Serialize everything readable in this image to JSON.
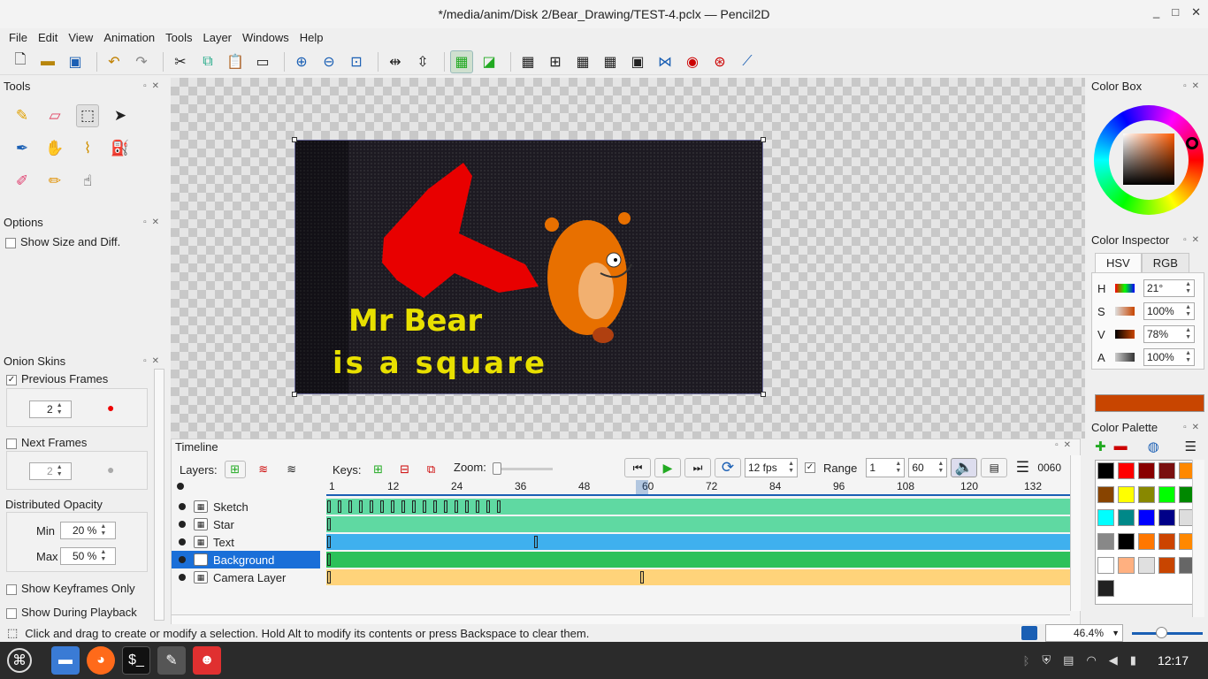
{
  "window": {
    "title": "*/media/anim/Disk 2/Bear_Drawing/TEST-4.pclx — Pencil2D",
    "minimize": "_",
    "maximize": "□",
    "close": "✕"
  },
  "menu": [
    "File",
    "Edit",
    "View",
    "Animation",
    "Tools",
    "Layer",
    "Windows",
    "Help"
  ],
  "toolbar": {
    "icons": [
      "new-file",
      "open",
      "save",
      "undo",
      "redo",
      "cut",
      "copy",
      "paste",
      "clear-frame",
      "zoom-in",
      "zoom-out",
      "zoom-fit",
      "flip-horizontal",
      "flip-vertical",
      "overlay-a",
      "overlay-b",
      "grid",
      "center",
      "thirds",
      "golden-ratio",
      "safe-area",
      "camera-path",
      "onion-front",
      "onion-back",
      "perspective"
    ]
  },
  "tools": {
    "title": "Tools",
    "items": [
      "pencil",
      "eraser",
      "select",
      "pointer",
      "pen",
      "hand",
      "polyline",
      "bucket",
      "eyedropper",
      "brush",
      "smudge"
    ]
  },
  "options": {
    "title": "Options",
    "show_size": "Show Size and Diff."
  },
  "onion": {
    "title": "Onion Skins",
    "previous": "Previous Frames",
    "prev_value": "2",
    "next": "Next Frames",
    "next_value": "2",
    "distributed": "Distributed Opacity",
    "min_label": "Min",
    "min_value": "20 %",
    "max_label": "Max",
    "max_value": "50 %",
    "show_keyframes_only": "Show Keyframes Only",
    "show_during_playback": "Show During Playback"
  },
  "canvas": {
    "text_line1": "Mr Bear",
    "text_line2": "is a square",
    "text_color": "#e8e000",
    "shape_color": "#e80000",
    "bear_color": "#e87000"
  },
  "timeline": {
    "title": "Timeline",
    "layers_label": "Layers:",
    "keys_label": "Keys:",
    "zoom_label": "Zoom:",
    "fps": "12 fps",
    "range_label": "Range",
    "range_start": "1",
    "range_end": "60",
    "frame_counter": "0060",
    "ruler": [
      "1",
      "12",
      "24",
      "36",
      "48",
      "60",
      "72",
      "84",
      "96",
      "108",
      "120",
      "132"
    ],
    "layers": [
      {
        "name": "Sketch",
        "color": "#5fd9a2",
        "selected": false
      },
      {
        "name": "Star",
        "color": "#5fd9a2",
        "selected": false
      },
      {
        "name": "Text",
        "color": "#3fb0ee",
        "selected": false
      },
      {
        "name": "Background",
        "color": "#2cc15a",
        "selected": true
      },
      {
        "name": "Camera Layer",
        "color": "#ffd37a",
        "selected": false
      }
    ]
  },
  "colorbox": {
    "title": "Color Box"
  },
  "inspector": {
    "title": "Color Inspector",
    "tab_hsv": "HSV",
    "tab_rgb": "RGB",
    "h_label": "H",
    "h_value": "21°",
    "s_label": "S",
    "s_value": "100%",
    "v_label": "V",
    "v_value": "78%",
    "a_label": "A",
    "a_value": "100%",
    "current_color": "#c84500"
  },
  "palette": {
    "title": "Color Palette",
    "colors": [
      "#000000",
      "#ff0000",
      "#880000",
      "#7a1010",
      "#ff8800",
      "#884400",
      "#ffff00",
      "#888800",
      "#00ff00",
      "#008800",
      "#00ffff",
      "#008888",
      "#0000ff",
      "#000088",
      "#dddddd",
      "#888888",
      "#000000",
      "#ff7700",
      "#cc4400",
      "#ff8800",
      "#ffffff",
      "#ffb080",
      "#e0e0e0",
      "#c84500",
      "#666666",
      "#222222"
    ]
  },
  "status": {
    "text": "Click and drag to create or modify a selection. Hold Alt to modify its contents or press Backspace to clear them.",
    "zoom": "46.4%"
  },
  "taskbar": {
    "clock": "12:17"
  }
}
